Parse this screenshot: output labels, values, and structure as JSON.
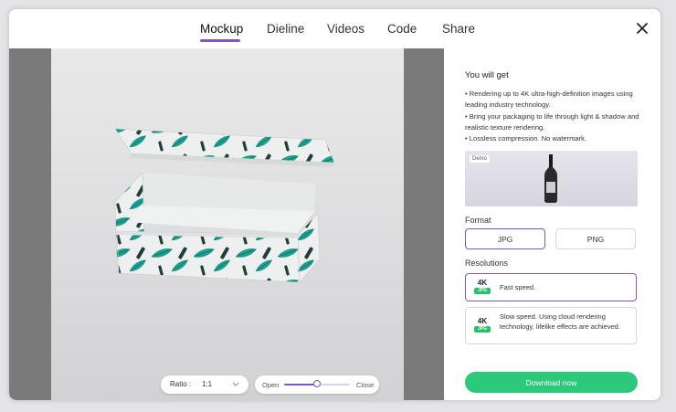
{
  "tabs": [
    {
      "label": "Mockup",
      "active": true
    },
    {
      "label": "Dieline",
      "active": false
    },
    {
      "label": "Videos",
      "active": false
    },
    {
      "label": "Code",
      "active": false
    },
    {
      "label": "Share",
      "active": false
    }
  ],
  "close_icon": "close-icon",
  "preview": {
    "ratio_label": "Ratio :",
    "ratio_value": "1:1",
    "open_label": "Open",
    "close_label": "Close",
    "open_close_fraction": 0.5
  },
  "panel": {
    "title": "You will get",
    "bullets": [
      "• Rendering up to 4K ultra-high-definition images using leading industry technology.",
      "• Bring your packaging to life through light & shadow and realistic texture rendering.",
      "• Lossless compression. No watermark."
    ],
    "demo_badge": "Demo",
    "format_label": "Format",
    "formats": [
      {
        "label": "JPG",
        "selected": true
      },
      {
        "label": "PNG",
        "selected": false
      }
    ],
    "resolutions_label": "Resolutions",
    "resolutions": [
      {
        "badge": "4K",
        "type": "JPG",
        "text": "Fast speed.",
        "selected": true
      },
      {
        "badge": "4K",
        "type": "JPG",
        "text": "Slow speed. Using cloud rendering technology, lifelike effects are achieved.",
        "selected": false
      }
    ],
    "download_label": "Download now"
  },
  "colors": {
    "accent": "#7e57c2",
    "download": "#2cc97a",
    "jpg_badge": "#2bbf6b",
    "leaf": "#1e9e8e"
  }
}
